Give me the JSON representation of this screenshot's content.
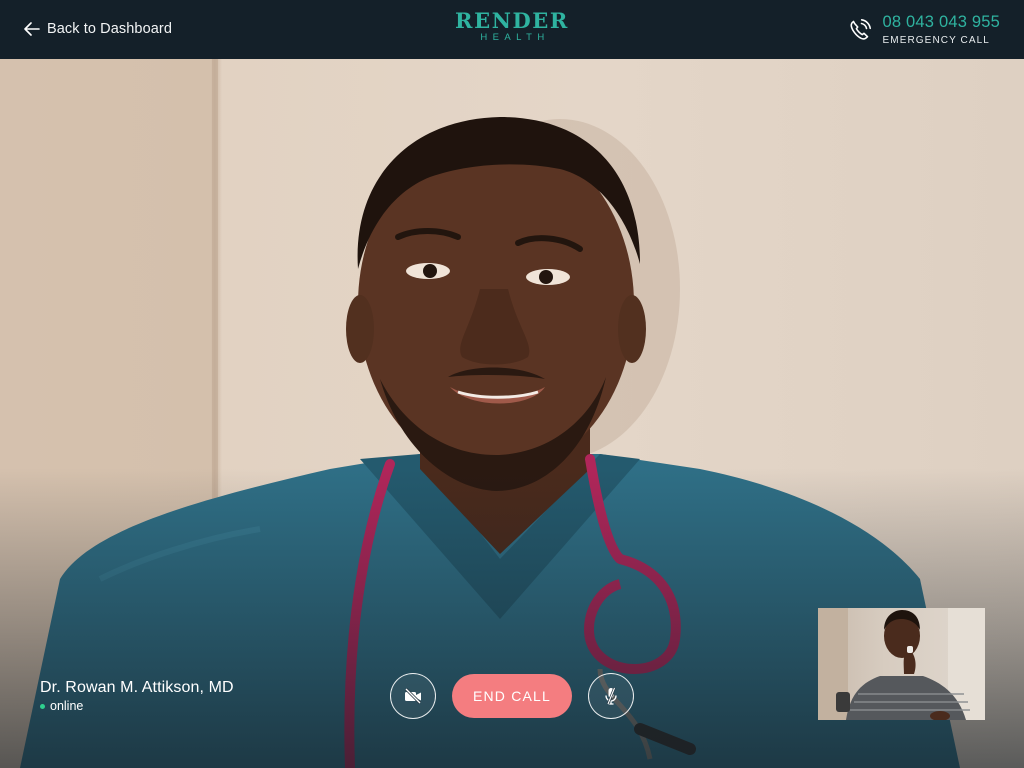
{
  "header": {
    "back_label": "Back to Dashboard",
    "logo_main": "RENDER",
    "logo_sub": "HEALTH",
    "emergency_number": "08 043 043 955",
    "emergency_label": "EMERGENCY CALL"
  },
  "call": {
    "caller_name": "Dr. Rowan M. Attikson, MD",
    "caller_status": "online",
    "end_call_label": "END CALL"
  },
  "icons": {
    "back": "arrow-left-icon",
    "phone": "phone-ringing-icon",
    "camera": "camera-off-icon",
    "mic": "microphone-off-icon"
  },
  "colors": {
    "brand": "#2fb3a0",
    "header_bg": "#142029",
    "end_call": "#f47d80",
    "online": "#2fd08f"
  }
}
